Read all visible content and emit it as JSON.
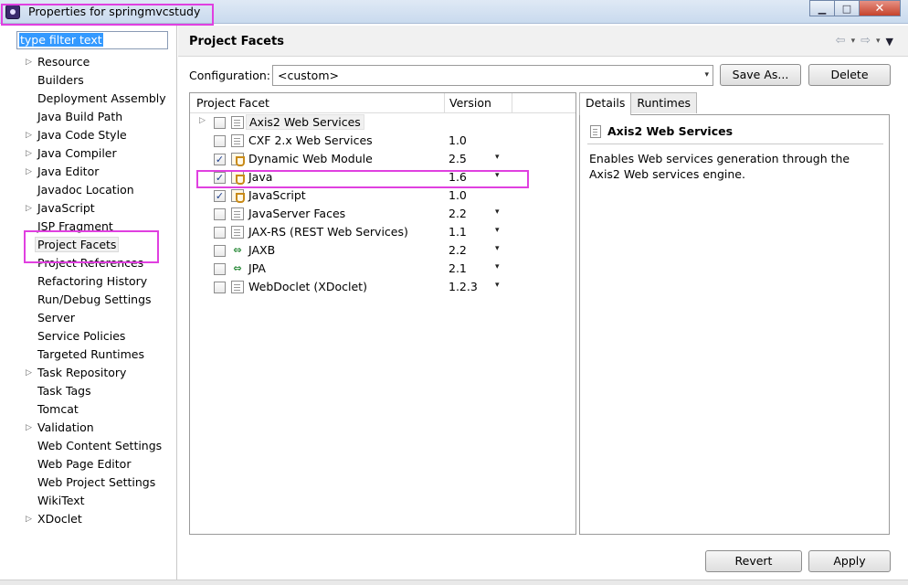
{
  "window": {
    "title": "Properties for springmvcstudy",
    "minimize_glyph": "▁",
    "maximize_glyph": "□",
    "close_glyph": "✕"
  },
  "filter": {
    "value": "type filter text"
  },
  "sidebar": {
    "items": [
      {
        "label": "Resource",
        "expandable": true
      },
      {
        "label": "Builders",
        "expandable": false
      },
      {
        "label": "Deployment Assembly",
        "expandable": false
      },
      {
        "label": "Java Build Path",
        "expandable": false
      },
      {
        "label": "Java Code Style",
        "expandable": true
      },
      {
        "label": "Java Compiler",
        "expandable": true
      },
      {
        "label": "Java Editor",
        "expandable": true
      },
      {
        "label": "Javadoc Location",
        "expandable": false
      },
      {
        "label": "JavaScript",
        "expandable": true
      },
      {
        "label": "JSP Fragment",
        "expandable": false
      },
      {
        "label": "Project Facets",
        "expandable": false,
        "selected": true
      },
      {
        "label": "Project References",
        "expandable": false
      },
      {
        "label": "Refactoring History",
        "expandable": false
      },
      {
        "label": "Run/Debug Settings",
        "expandable": false
      },
      {
        "label": "Server",
        "expandable": false
      },
      {
        "label": "Service Policies",
        "expandable": false
      },
      {
        "label": "Targeted Runtimes",
        "expandable": false
      },
      {
        "label": "Task Repository",
        "expandable": true
      },
      {
        "label": "Task Tags",
        "expandable": false
      },
      {
        "label": "Tomcat",
        "expandable": false
      },
      {
        "label": "Validation",
        "expandable": true
      },
      {
        "label": "Web Content Settings",
        "expandable": false
      },
      {
        "label": "Web Page Editor",
        "expandable": false
      },
      {
        "label": "Web Project Settings",
        "expandable": false
      },
      {
        "label": "WikiText",
        "expandable": false
      },
      {
        "label": "XDoclet",
        "expandable": true
      }
    ]
  },
  "header": {
    "title": "Project Facets",
    "back_glyph": "⇦",
    "forward_glyph": "⇨",
    "dropdown_glyph": "▾",
    "menu_glyph": "▼"
  },
  "config": {
    "label": "Configuration:",
    "value": "<custom>",
    "dropdown_glyph": "▾",
    "save_as_label": "Save As...",
    "delete_label": "Delete"
  },
  "facets": {
    "col_facet": "Project Facet",
    "col_version": "Version",
    "rows": [
      {
        "name": "Axis2 Web Services",
        "version": "",
        "checked": false,
        "icon": "doc",
        "expandable": true,
        "dropdown": false,
        "boxed": true
      },
      {
        "name": "CXF 2.x Web Services",
        "version": "1.0",
        "checked": false,
        "icon": "doc",
        "expandable": false,
        "dropdown": false
      },
      {
        "name": "Dynamic Web Module",
        "version": "2.5",
        "checked": true,
        "icon": "java",
        "expandable": false,
        "dropdown": true
      },
      {
        "name": "Java",
        "version": "1.6",
        "checked": true,
        "icon": "java",
        "expandable": false,
        "dropdown": true
      },
      {
        "name": "JavaScript",
        "version": "1.0",
        "checked": true,
        "icon": "java",
        "expandable": false,
        "dropdown": false
      },
      {
        "name": "JavaServer Faces",
        "version": "2.2",
        "checked": false,
        "icon": "doc",
        "expandable": false,
        "dropdown": true
      },
      {
        "name": "JAX-RS (REST Web Services)",
        "version": "1.1",
        "checked": false,
        "icon": "doc",
        "expandable": false,
        "dropdown": true
      },
      {
        "name": "JAXB",
        "version": "2.2",
        "checked": false,
        "icon": "jx",
        "expandable": false,
        "dropdown": true
      },
      {
        "name": "JPA",
        "version": "2.1",
        "checked": false,
        "icon": "jx",
        "expandable": false,
        "dropdown": true
      },
      {
        "name": "WebDoclet (XDoclet)",
        "version": "1.2.3",
        "checked": false,
        "icon": "doc",
        "expandable": false,
        "dropdown": true
      }
    ]
  },
  "details": {
    "tab_details": "Details",
    "tab_runtimes": "Runtimes",
    "title": "Axis2 Web Services",
    "description": "Enables Web services generation through the Axis2 Web services engine."
  },
  "footer": {
    "revert_label": "Revert",
    "apply_label": "Apply"
  },
  "highlight_color": "#e040e0"
}
